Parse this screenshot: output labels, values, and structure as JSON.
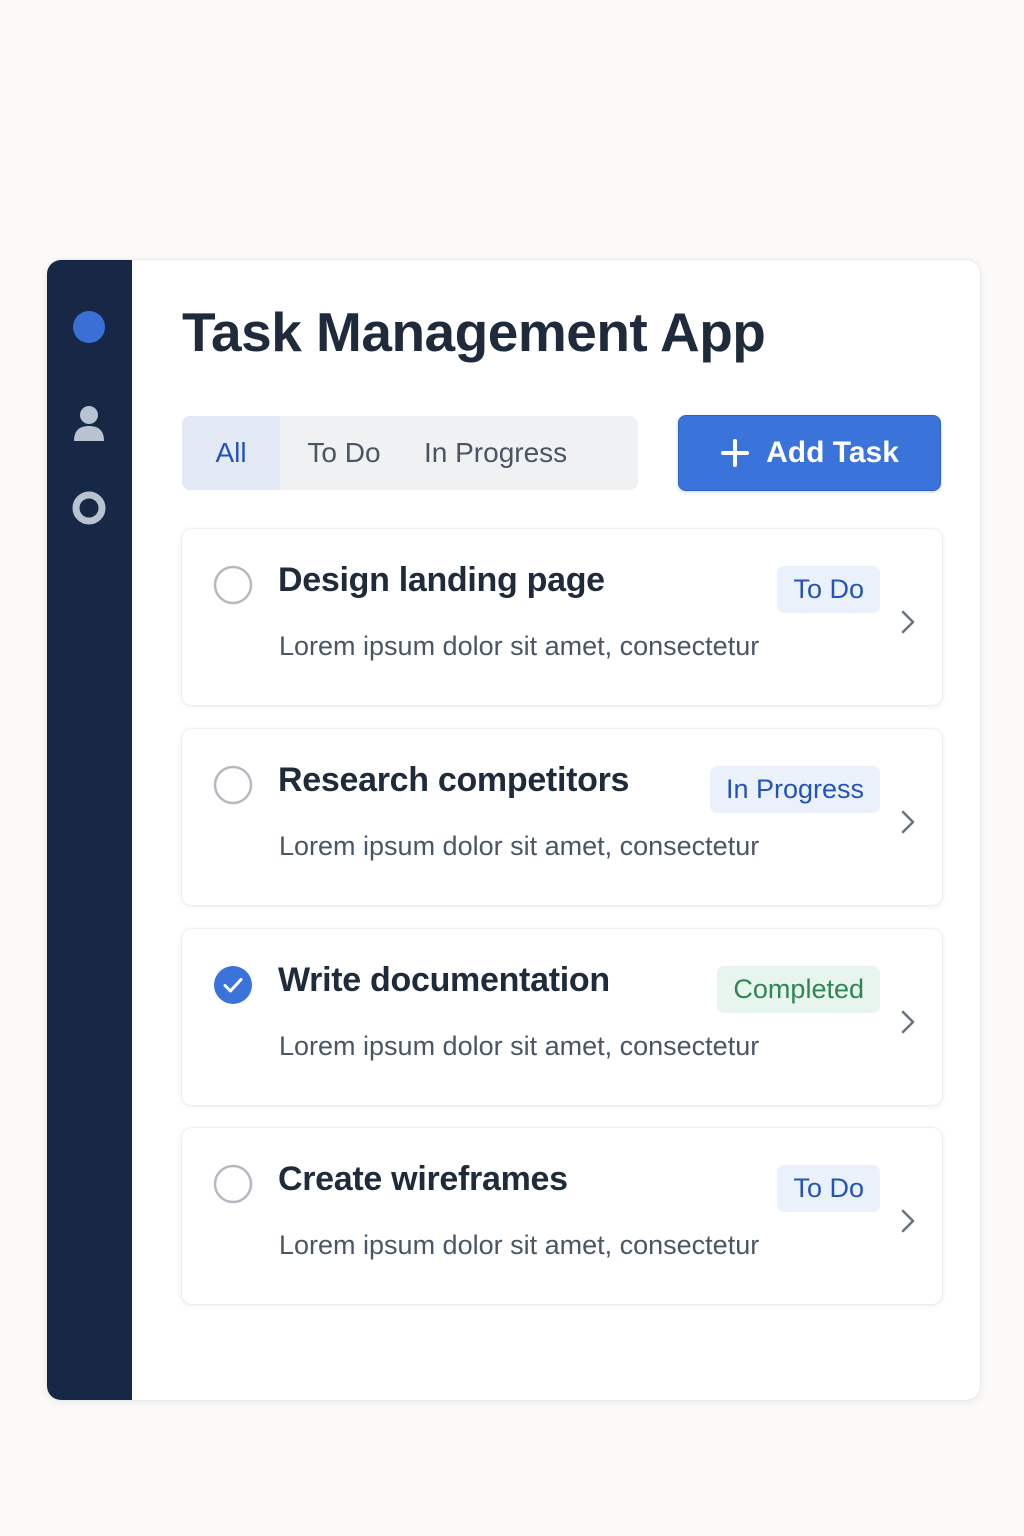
{
  "app": {
    "title": "Task Management App"
  },
  "sidebar": {
    "items": [
      {
        "icon": "circle-dot-icon",
        "color": "#3a6fd6"
      },
      {
        "icon": "user-icon",
        "color": "#b9c2d0"
      },
      {
        "icon": "settings-ring-icon",
        "color": "#b9c2d0"
      }
    ]
  },
  "filters": {
    "tabs": [
      {
        "label": "All",
        "active": true
      },
      {
        "label": "To Do",
        "active": false
      },
      {
        "label": "In Progress",
        "active": false
      }
    ]
  },
  "toolbar": {
    "add_label": "Add Task",
    "add_icon": "plus-icon"
  },
  "tasks": [
    {
      "title": "Design landing page",
      "description": "Lorem ipsum dolor sit amet, consectetur",
      "status": "To Do",
      "completed": false
    },
    {
      "title": "Research competitors",
      "description": "Lorem ipsum dolor sit amet, consectetur",
      "status": "In Progress",
      "completed": false
    },
    {
      "title": "Write documentation",
      "description": "Lorem ipsum dolor sit amet, consectetur",
      "status": "Completed",
      "completed": true
    },
    {
      "title": "Create wireframes",
      "description": "Lorem ipsum dolor sit amet, consectetur",
      "status": "To Do",
      "completed": false
    }
  ],
  "colors": {
    "sidebar_bg": "#172846",
    "accent": "#3a73d9",
    "status_todo": "#2454b8",
    "status_completed": "#2e8652"
  }
}
